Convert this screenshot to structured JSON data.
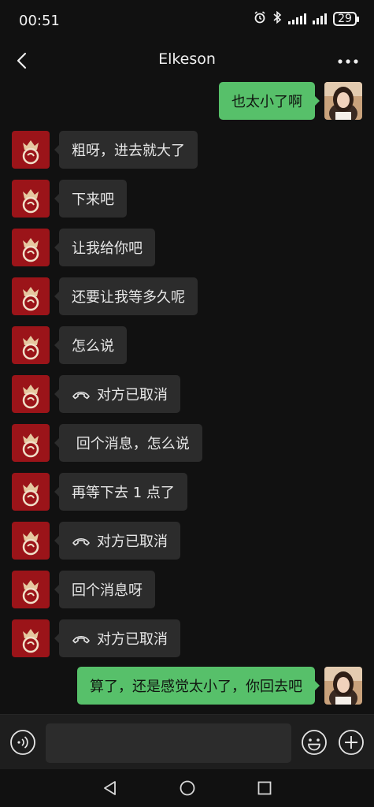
{
  "status_bar": {
    "time": "00:51",
    "battery": "29",
    "icons": [
      "alarm-icon",
      "bluetooth-icon",
      "signal-icon",
      "signal-icon",
      "battery-icon"
    ]
  },
  "header": {
    "title": "Elkeson",
    "back_icon": "chevron-left-icon",
    "more_icon": "more-dots-icon"
  },
  "messages": [
    {
      "side": "right",
      "text": "也太小了啊",
      "call": false
    },
    {
      "side": "left",
      "text": "粗呀，进去就大了",
      "call": false
    },
    {
      "side": "left",
      "text": "下来吧",
      "call": false
    },
    {
      "side": "left",
      "text": "让我给你吧",
      "call": false
    },
    {
      "side": "left",
      "text": "还要让我等多久呢",
      "call": false
    },
    {
      "side": "left",
      "text": "怎么说",
      "call": false
    },
    {
      "side": "left",
      "text": "对方已取消",
      "call": true
    },
    {
      "side": "left",
      "text": " 回个消息，怎么说",
      "call": false
    },
    {
      "side": "left",
      "text": "再等下去 1 点了",
      "call": false
    },
    {
      "side": "left",
      "text": "对方已取消",
      "call": true
    },
    {
      "side": "left",
      "text": "回个消息呀",
      "call": false
    },
    {
      "side": "left",
      "text": "对方已取消",
      "call": true
    },
    {
      "side": "right",
      "text": "算了，还是感觉太小了，你回去吧",
      "call": false
    }
  ],
  "input_bar": {
    "placeholder": "",
    "voice_icon": "voice-icon",
    "emoji_icon": "emoji-icon",
    "plus_icon": "plus-icon"
  },
  "nav": {
    "icons": [
      "nav-back-icon",
      "nav-home-icon",
      "nav-recent-icon"
    ]
  },
  "colors": {
    "background": "#111111",
    "bubble_incoming": "#2c2c2c",
    "bubble_outgoing": "#57c06a",
    "avatar_contact": "#9b1419"
  }
}
